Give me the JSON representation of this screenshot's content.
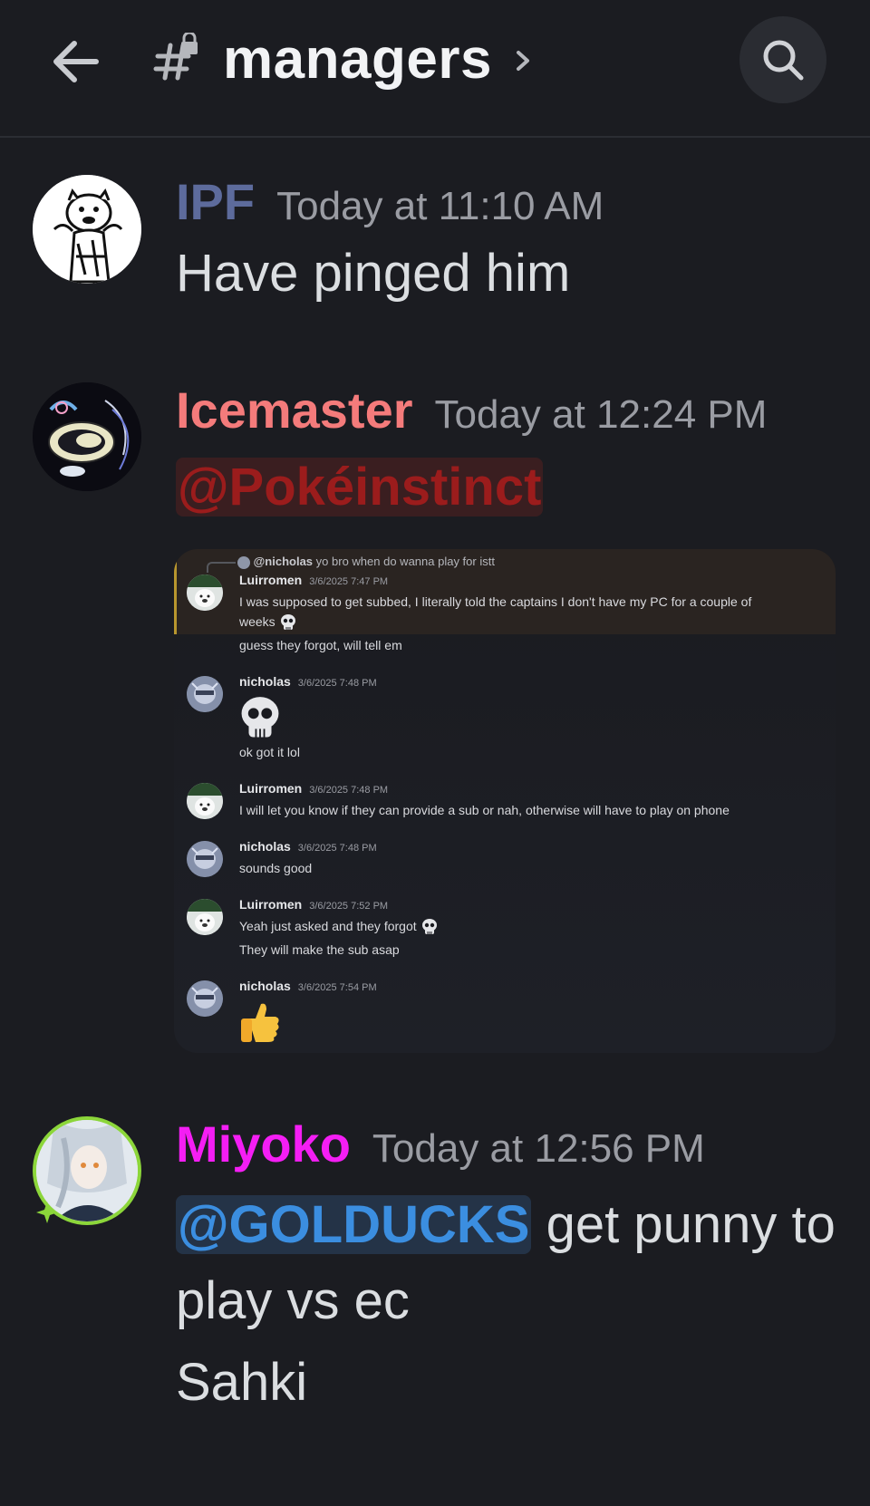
{
  "header": {
    "channel_name": "managers",
    "icons": [
      "back-arrow-icon",
      "locked-channel-hash-icon",
      "chevron-right-icon",
      "search-icon"
    ]
  },
  "messages": [
    {
      "author": "IPF",
      "author_color": "#5d6b9c",
      "timestamp": "Today at 11:10 AM",
      "text": "Have pinged him"
    },
    {
      "author": "Icemaster",
      "author_color": "#f47b7b",
      "timestamp": "Today at 12:24 PM",
      "mention": "@Pokéinstinct"
    },
    {
      "author": "Miyoko",
      "author_color": "#f41ef4",
      "timestamp": "Today at 12:56 PM",
      "mention": "@GOLDUCKS",
      "text_after_mention": " get punny to",
      "line2": "play vs ec",
      "line3": "Sahki"
    }
  ],
  "embed": {
    "reply": {
      "mention": "@nicholas",
      "text": "yo bro when do wanna play for istt"
    },
    "items": [
      {
        "author": "Luirromen",
        "timestamp": "3/6/2025 7:47 PM",
        "lines": [
          "I was supposed to get subbed, I literally told the captains I don't have my PC for a couple of",
          "weeks",
          "guess they forgot, will tell em"
        ]
      },
      {
        "author": "nicholas",
        "timestamp": "3/6/2025 7:48 PM",
        "lines": [
          "ok got it lol"
        ]
      },
      {
        "author": "Luirromen",
        "timestamp": "3/6/2025 7:48 PM",
        "lines": [
          "I will let you know if they can provide a sub or nah, otherwise will have to play on phone"
        ]
      },
      {
        "author": "nicholas",
        "timestamp": "3/6/2025 7:48 PM",
        "lines": [
          "sounds good"
        ]
      },
      {
        "author": "Luirromen",
        "timestamp": "3/6/2025 7:52 PM",
        "lines": [
          "Yeah just asked and they forgot",
          "They will make the sub asap"
        ]
      },
      {
        "author": "nicholas",
        "timestamp": "3/6/2025 7:54 PM",
        "lines": []
      }
    ]
  }
}
